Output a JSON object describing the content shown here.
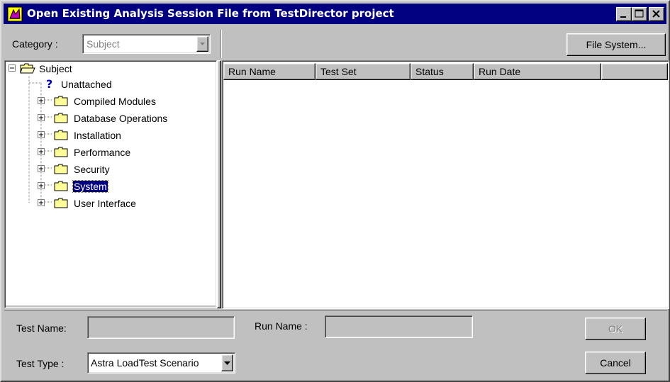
{
  "window": {
    "title": "Open Existing Analysis Session File from TestDirector project",
    "controls": [
      "minimize-icon",
      "maximize-icon",
      "close-icon"
    ]
  },
  "category": {
    "label": "Category :",
    "value": "Subject"
  },
  "file_system_button": "File System...",
  "tree": {
    "root": "Subject",
    "items": [
      {
        "label": "Unattached",
        "icon": "question-icon",
        "expandable": false,
        "selected": false
      },
      {
        "label": "Compiled Modules",
        "icon": "folder-icon",
        "expandable": true,
        "selected": false
      },
      {
        "label": "Database Operations",
        "icon": "folder-icon",
        "expandable": true,
        "selected": false
      },
      {
        "label": "Installation",
        "icon": "folder-icon",
        "expandable": true,
        "selected": false
      },
      {
        "label": "Performance",
        "icon": "folder-icon",
        "expandable": true,
        "selected": false
      },
      {
        "label": "Security",
        "icon": "folder-icon",
        "expandable": true,
        "selected": false
      },
      {
        "label": "System",
        "icon": "folder-icon",
        "expandable": true,
        "selected": true
      },
      {
        "label": "User Interface",
        "icon": "folder-icon",
        "expandable": true,
        "selected": false
      }
    ]
  },
  "run_list": {
    "columns": [
      "Run Name",
      "Test Set",
      "Status",
      "Run Date",
      ""
    ],
    "rows": []
  },
  "bottom": {
    "test_name_label": "Test Name:",
    "test_name_value": "",
    "run_name_label": "Run Name :",
    "run_name_value": "",
    "test_type_label": "Test Type :",
    "test_type_value": "Astra LoadTest Scenario"
  },
  "buttons": {
    "ok": "OK",
    "cancel": "Cancel"
  },
  "colors": {
    "titlebar": "#000080",
    "face": "#c0c0c0",
    "selection": "#000080",
    "folder": "#ffff99"
  }
}
